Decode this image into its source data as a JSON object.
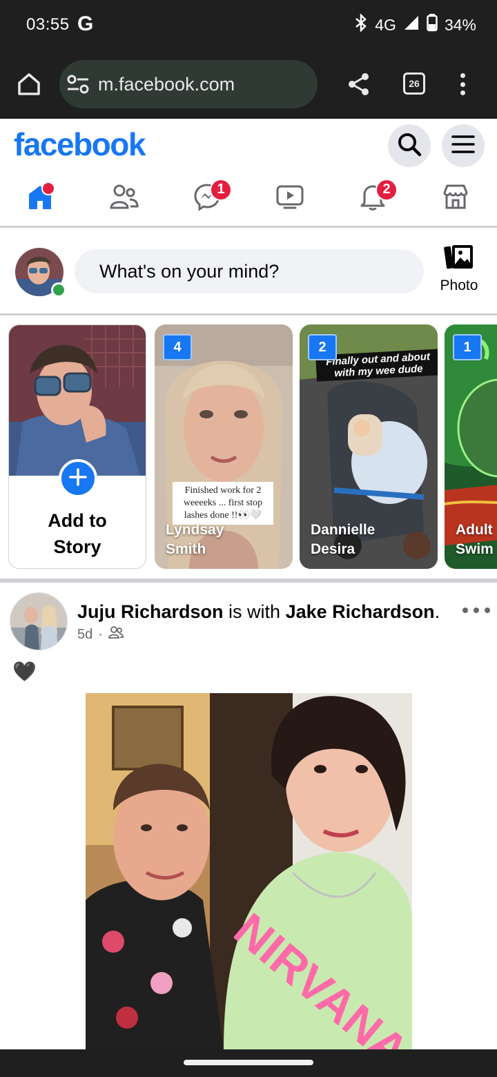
{
  "status_bar": {
    "time": "03:55",
    "google_glyph": "G",
    "network": "4G",
    "battery": "34%",
    "icons": [
      "bluetooth-icon",
      "signal-icon",
      "battery-icon"
    ]
  },
  "browser": {
    "url": "m.facebook.com",
    "tab_count": "26",
    "icons": [
      "home-icon",
      "site-settings-icon",
      "share-icon",
      "tab-switcher-icon",
      "overflow-menu-icon"
    ]
  },
  "fb_header": {
    "logo": "facebook",
    "brand_color": "#1877f2"
  },
  "tabs": [
    {
      "name": "home",
      "icon": "home-icon",
      "badge": ""
    },
    {
      "name": "friends",
      "icon": "friends-icon",
      "badge": ""
    },
    {
      "name": "messenger",
      "icon": "messenger-icon",
      "badge": "1"
    },
    {
      "name": "watch",
      "icon": "video-icon",
      "badge": ""
    },
    {
      "name": "notifications",
      "icon": "bell-icon",
      "badge": "2"
    },
    {
      "name": "marketplace",
      "icon": "store-icon",
      "badge": ""
    }
  ],
  "composer": {
    "placeholder": "What's on your mind?",
    "photo_label": "Photo"
  },
  "stories": {
    "add_label_line1": "Add to",
    "add_label_line2": "Story",
    "items": [
      {
        "count": "4",
        "name_line1": "Lyndsay",
        "name_line2": "Smith",
        "caption": "Finished work for 2 weeeeks ... first stop lashes done !!👀🤍"
      },
      {
        "count": "2",
        "name_line1": "Dannielle",
        "name_line2": "Desira",
        "caption": "Finally out and about with my wee dude"
      },
      {
        "count": "1",
        "name_line1": "Adult",
        "name_line2": "Swim",
        "caption": ""
      }
    ]
  },
  "post": {
    "author": "Juju Richardson",
    "with_text": " is with ",
    "tagged": "Jake Richardson",
    "period": ".",
    "time": "5d",
    "dot": "·",
    "audience_icon": "friends-audience-icon",
    "text": "🖤"
  }
}
